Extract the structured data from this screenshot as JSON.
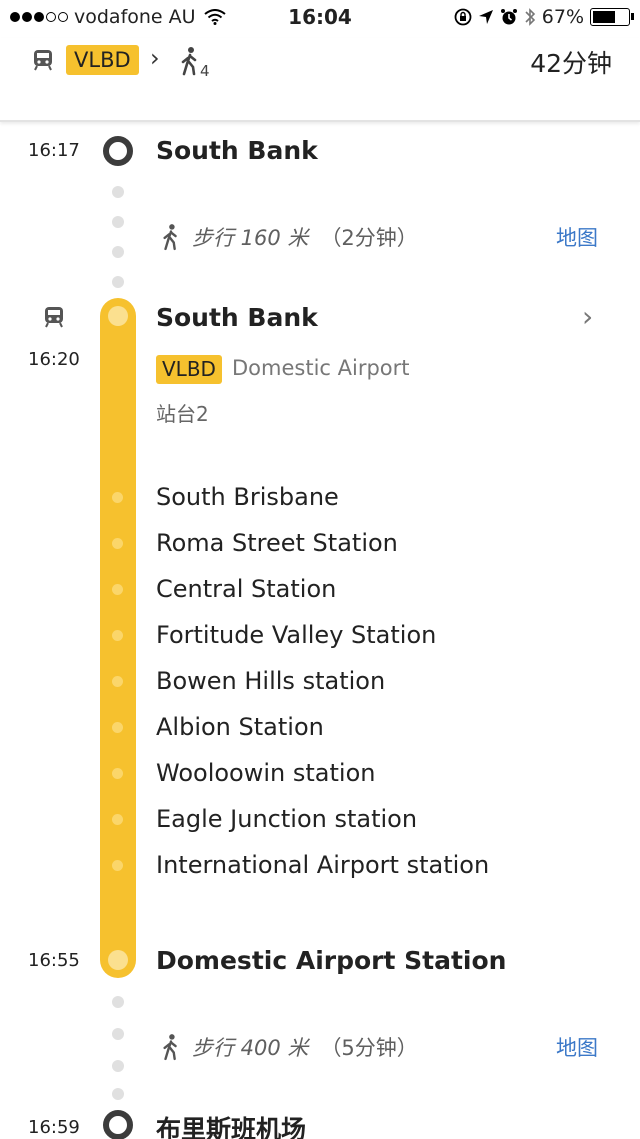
{
  "status_bar": {
    "carrier": "vodafone AU",
    "time": "16:04",
    "battery": "67%"
  },
  "header": {
    "route": "VLBD",
    "walk_segments": "4",
    "duration": "42分钟"
  },
  "timeline": {
    "start": {
      "time": "16:17",
      "name": "South Bank"
    },
    "walk1": {
      "distance": "步行 160 米",
      "duration": "（2分钟）",
      "map_label": "地图"
    },
    "board": {
      "name": "South Bank",
      "time": "16:20",
      "route": "VLBD",
      "direction": "Domestic Airport",
      "platform": "站台2"
    },
    "intermediate_stops": [
      "South Brisbane",
      "Roma Street Station",
      "Central Station",
      "Fortitude Valley Station",
      "Bowen Hills station",
      "Albion Station",
      "Wooloowin station",
      "Eagle Junction station",
      "International Airport station"
    ],
    "alight": {
      "time": "16:55",
      "name": "Domestic Airport Station"
    },
    "walk2": {
      "distance": "步行 400 米",
      "duration": "（5分钟）",
      "map_label": "地图"
    },
    "destination": {
      "time": "16:59",
      "name": "布里斯班机场"
    }
  },
  "colors": {
    "line": "#f6c12e",
    "link": "#3b78c8"
  }
}
